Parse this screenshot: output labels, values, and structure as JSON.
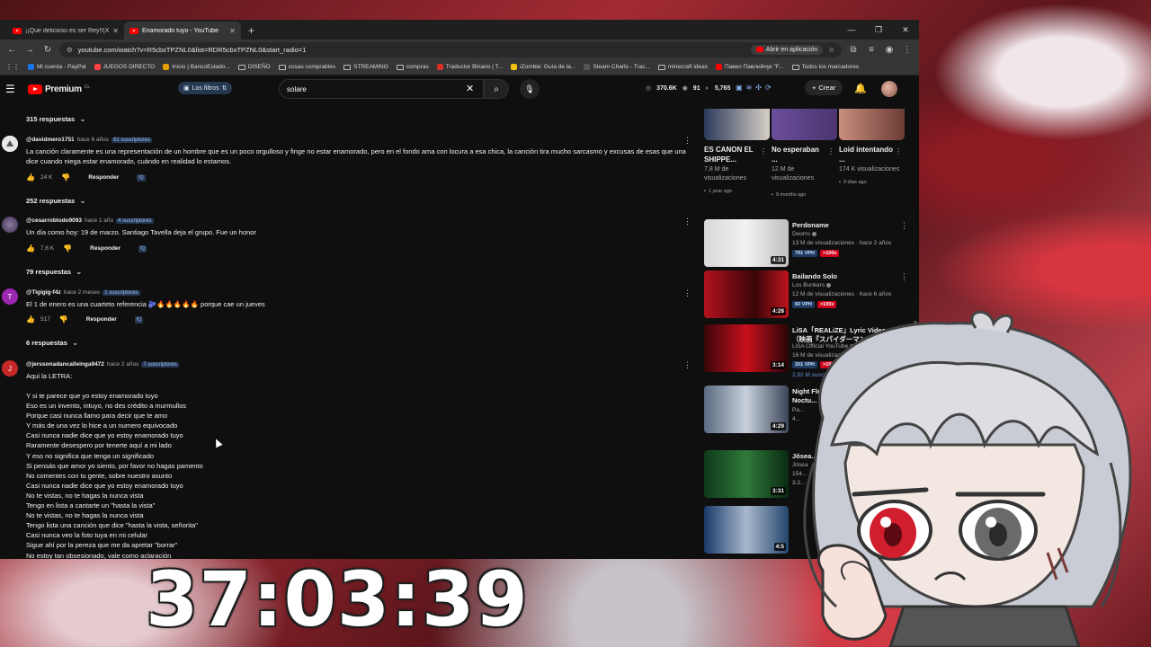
{
  "browser": {
    "tabs": [
      {
        "title": "¡¡Que delicioso es ser Rey!!(Xo...",
        "active": false
      },
      {
        "title": "Enamorado tuyo - YouTube",
        "active": true
      }
    ],
    "url": "youtube.com/watch?v=R5cbxTPZNL0&list=RDR5cbxTPZNL0&start_radio=1",
    "open_app_label": "Abrir en aplicación",
    "bookmarks": [
      "Mi cuenta - PayPal",
      "JUEGOS DIRECTO",
      "Inicio | BancoEstado...",
      "DISEÑO",
      "cosas comprables",
      "STREAMING",
      "compras",
      "Traductor Binario | T...",
      "iZombie: Guía de la...",
      "Steam Charts - Trac...",
      "minecraft ideas",
      "Павел Павлийчук \"F...",
      "Todos los marcadores"
    ]
  },
  "yt_header": {
    "brand": "Premium",
    "country": "CL",
    "filters_label": "Los filtros",
    "search_value": "solare",
    "stats": {
      "views": "370.6K",
      "subs": "91",
      "other": "5,765"
    },
    "create_label": "Crear"
  },
  "comments": {
    "replies_1": "315 respuestas",
    "c1": {
      "avatar_letter": "",
      "handle": "@davidmero1751",
      "time": "hace 6 años",
      "subs": "61 suscriptores",
      "text": "La canción claramente es una representación de un hombre que es un poco orgulloso y finge no estar enamorado, pero en el fondo ama con locura a esa chica, la canción tira mucho sarcasmo y excusas de esas que una dice cuando niega estar enamorado, cuándo en realidad lo estamos.",
      "likes": "24 K",
      "reply": "Responder",
      "iq": "IQ"
    },
    "replies_2": "252 respuestas",
    "c2": {
      "handle": "@cesarroblodo9093",
      "time": "hace 1 año",
      "subs": "4 suscriptores",
      "text": "Un día como hoy: 19 de marzo. Santiago Tavella deja el grupo. Fue un honor",
      "likes": "7,6 K",
      "reply": "Responder",
      "iq": "IQ"
    },
    "replies_3": "79 respuestas",
    "c3": {
      "avatar_letter": "T",
      "handle": "@Tigigig-f4z",
      "time": "hace 2 meses",
      "subs": "1 suscriptores",
      "text": "El 1 de enero es una cuarteto referencia 🫐🔥🔥🔥🔥🔥 porque cae un jueves",
      "likes": "517",
      "reply": "Responder",
      "iq": "IQ"
    },
    "replies_4": "6 respuestas",
    "c4": {
      "avatar_letter": "J",
      "handle": "@jerssonadancalleinga9472",
      "time": "hace 2 años",
      "subs": "7 suscriptores",
      "intro": "Aqui la LETRA:",
      "lyrics": [
        "Y si te parece que yo estoy enamorado tuyo",
        "Eso es un invento, intuyo, no des crédito a murmullos",
        "Porque casi nunca llamo para decir que te amo",
        "Y más de una vez lo hice a un numero equivocado",
        "Casi nunca nadie dice que yo estoy enamorado tuyo",
        "Raramente desespero por tenerte aquí a mi lado",
        "Y eso no significa que tenga un significado",
        "Si pensás que amor yo siento, por favor no hagas pamento",
        "No comentes con tu gente, sobre nuestro asunto",
        "Casi nunca nadie dice que yo estoy enamorado tuyo",
        "No te vistas, no te hagas la nunca vista",
        "Tengo en lista a cantarte un \"hasta la vista\"",
        "No te vistas, no te hagas la nunca vista",
        "Tengo lista una canción que dice \"hasta la vista, señorita\"",
        "Casi nunca veo la foto tuya en mi celular",
        "Sigue ahí por la pereza que me da apretar \"borrar\"",
        "No estoy tan obsesionado, vale como aclaración"
      ]
    }
  },
  "shorts": [
    {
      "title": "ES CANON EL SHIPPE...",
      "views": "7,8 M de visualizaciones",
      "age": "1 year ago"
    },
    {
      "title": "No esperaban ...",
      "views": "12 M de visualizaciones",
      "age": "9 months ago"
    },
    {
      "title": "Loid intentando ...",
      "views": "174 K visualizaciones",
      "age": "3 días ago"
    }
  ],
  "recommendations": [
    {
      "title": "Perdoname",
      "channel": "Deorro",
      "meta": "13 M de visualizaciones · hace 2 años",
      "vph": "791 VPH",
      "mult": ">100x",
      "duration": "4:31"
    },
    {
      "title": "Bailando Solo",
      "channel": "Los Bunkers",
      "meta": "12 M de visualizaciones · hace 6 años",
      "vph": "60 VPH",
      "mult": ">100x",
      "duration": "4:28"
    },
    {
      "title": "LiSA「REALiZE」Lyric Video（映画『スパイダーマン：ア...",
      "channel": "LiSA Official YouTube",
      "meta": "16 M de visualizaciones · hace 2 años",
      "vph": "201 VPH",
      "mult": ">100x",
      "extra": "2,92 M suscriptores",
      "duration": "3:14"
    },
    {
      "title": "Night Flower - Yeo... [Pintor Noctu...",
      "channel": "Pa...",
      "meta": "4...",
      "duration": "4:29"
    },
    {
      "title": "Jósea...",
      "channel": "Jósea",
      "meta": "154...",
      "extra2": "3.3...",
      "duration": "3:31"
    },
    {
      "title": "",
      "channel": "",
      "meta": "",
      "duration": "4:5"
    }
  ],
  "overlay": {
    "timer": "37:03:39"
  },
  "colors": {
    "youtube_red": "#ff0000",
    "vph_badge": "#1f3a5f",
    "multiplier_badge": "#d0021b"
  }
}
